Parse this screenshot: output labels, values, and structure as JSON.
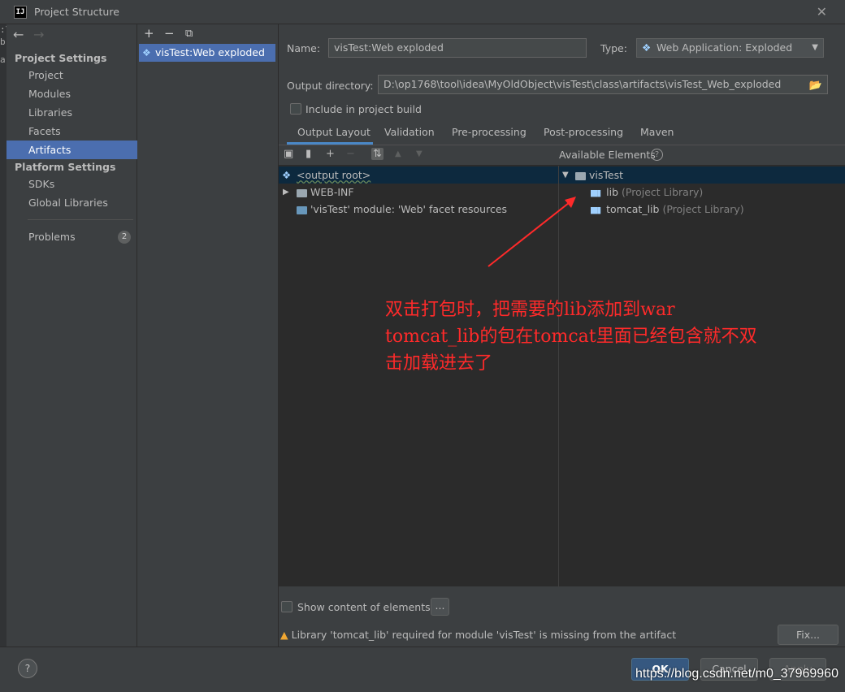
{
  "window": {
    "title": "Project Structure",
    "icon_text": "IJ"
  },
  "left_edge_chars": [
    ":\\",
    "b",
    "a"
  ],
  "sidebar": {
    "back_arrow": "←",
    "forward_arrow": "→",
    "project_settings_title": "Project Settings",
    "project_items": [
      "Project",
      "Modules",
      "Libraries",
      "Facets",
      "Artifacts"
    ],
    "selected_item": "Artifacts",
    "platform_settings_title": "Platform Settings",
    "platform_items": [
      "SDKs",
      "Global Libraries"
    ],
    "problems_label": "Problems",
    "problems_count": "2"
  },
  "artifacts_panel": {
    "add": "+",
    "remove": "−",
    "copy": "⧉",
    "items": [
      "visTest:Web exploded"
    ]
  },
  "main": {
    "name_label": "Name:",
    "name_value": "visTest:Web exploded",
    "type_label": "Type:",
    "type_value": "Web Application: Exploded",
    "output_dir_label": "Output directory:",
    "output_dir_value": "D:\\op1768\\tool\\idea\\MyOldObject\\visTest\\class\\artifacts\\visTest_Web_exploded",
    "include_build_label": "Include in project build",
    "tabs": [
      "Output Layout",
      "Validation",
      "Pre-processing",
      "Post-processing",
      "Maven"
    ],
    "active_tab": "Output Layout",
    "available_elements_label": "Available Elements",
    "output_tree": [
      {
        "label": "<output root>"
      },
      {
        "label": "WEB-INF"
      },
      {
        "label": "'visTest' module: 'Web' facet resources"
      }
    ],
    "available_tree": {
      "root": "visTest",
      "children": [
        {
          "name": "lib",
          "suffix": "(Project Library)"
        },
        {
          "name": "tomcat_lib",
          "suffix": "(Project Library)"
        }
      ]
    },
    "annotation_lines": [
      "双击打包时，把需要的lib添加到war",
      "tomcat_lib的包在tomcat里面已经包含就不双",
      "击加载进去了"
    ],
    "annotation_color": "#ff2a2a",
    "show_content_label": "Show content of elements",
    "dots_label": "...",
    "warning_text": "Library 'tomcat_lib' required for module 'visTest' is missing from the artifact",
    "fix_label": "Fix..."
  },
  "footer": {
    "help": "?",
    "ok": "OK",
    "cancel": "Cancel",
    "apply": "Apply",
    "watermark": "https://blog.csdn.net/m0_37969960"
  }
}
